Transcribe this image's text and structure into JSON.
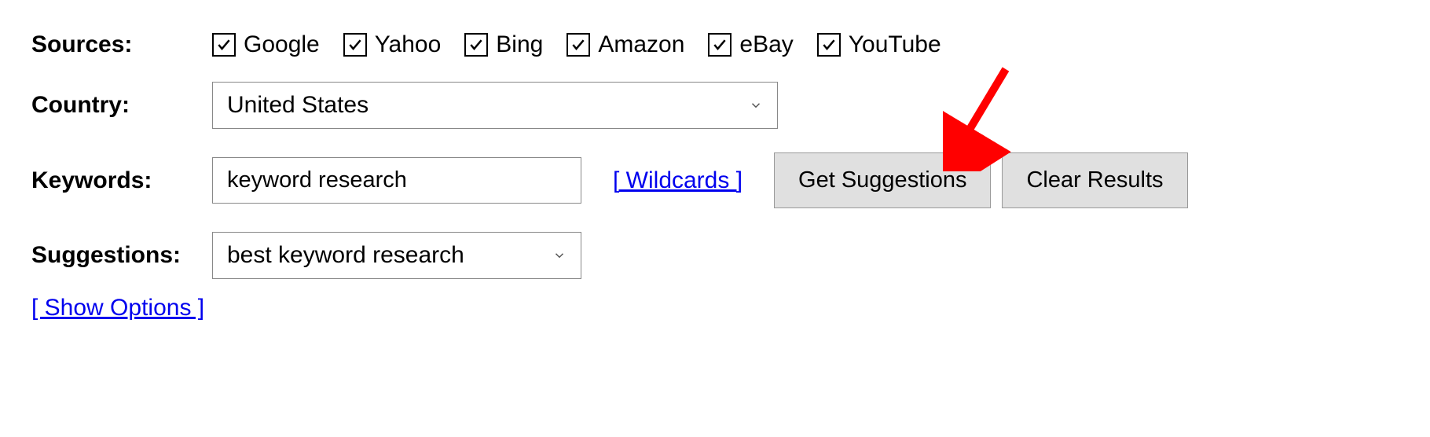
{
  "labels": {
    "sources": "Sources:",
    "country": "Country:",
    "keywords": "Keywords:",
    "suggestions": "Suggestions:"
  },
  "sources": {
    "google": "Google",
    "yahoo": "Yahoo",
    "bing": "Bing",
    "amazon": "Amazon",
    "ebay": "eBay",
    "youtube": "YouTube"
  },
  "country": {
    "selected": "United States"
  },
  "keywords": {
    "value": "keyword research"
  },
  "suggestions": {
    "selected": "best keyword research"
  },
  "links": {
    "wildcards": "[ Wildcards ]",
    "show_options": "[ Show Options ]"
  },
  "buttons": {
    "get_suggestions": "Get Suggestions",
    "clear_results": "Clear Results"
  }
}
